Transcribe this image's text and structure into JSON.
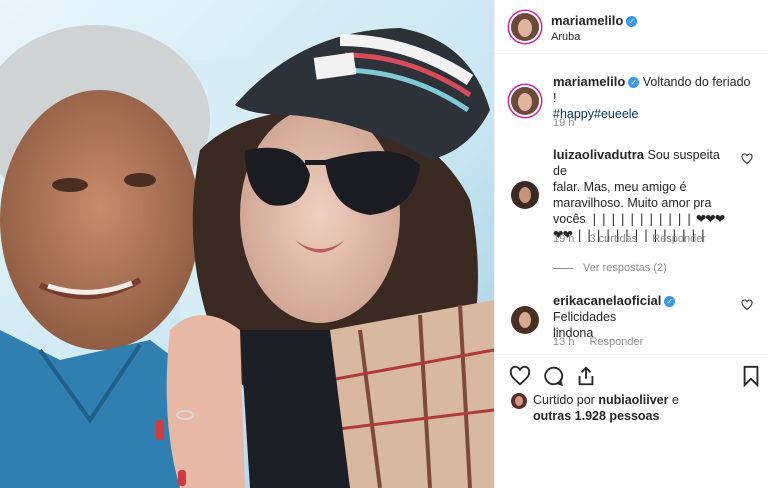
{
  "post": {
    "author": "mariamelilo",
    "location": "Aruba"
  },
  "caption": {
    "author": "mariamelilo",
    "text": "Voltando do feriado !",
    "hashtags": "#happy#eueele",
    "time": "19 h"
  },
  "comments": [
    {
      "author": "luizaolivadutra",
      "text": "Sou suspeita de falar. Mas, meu amigo é maravilhoso. Muito amor pra vocês",
      "text_lines": [
        "Sou suspeita de",
        "falar. Mas, meu amigo é",
        "maravilhoso. Muito amor pra",
        "vocês"
      ],
      "time": "19 h",
      "likes": "3 curtidas",
      "reply": "Responder"
    },
    {
      "author": "erikacanelaoficial",
      "text_lines": [
        "Felicidades",
        "lindona"
      ],
      "time": "13 h",
      "reply": "Responder"
    }
  ],
  "view_replies": "Ver respostas (2)",
  "likes": {
    "prefix": "Curtido por",
    "user": "nubiaoliiver",
    "conj": "e",
    "others": "outras 1.928 pessoas"
  },
  "colors": {
    "link": "#003569",
    "verified": "#3897f0",
    "muted": "#8e8e8e",
    "text": "#262626"
  },
  "icons": [
    "heart-icon",
    "comment-icon",
    "share-icon",
    "bookmark-icon",
    "verified-icon"
  ]
}
